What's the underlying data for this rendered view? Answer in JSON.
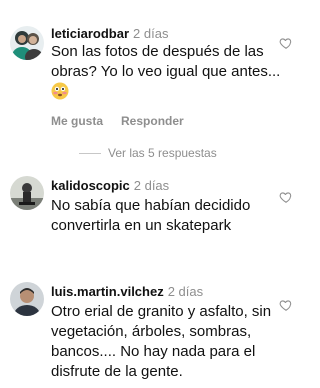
{
  "comments": [
    {
      "username": "leticiarodbar",
      "time": "2 días",
      "text": "Son las fotos de después de las obras? Yo lo veo igual que antes...",
      "emoji": "flushed-face",
      "like_label": "Me gusta",
      "reply_label": "Responder",
      "replies_label": "Ver las 5 respuestas"
    },
    {
      "username": "kalidoscopic",
      "time": "2 días",
      "text": "No sabía que habían decidido convertirla en un skatepark"
    },
    {
      "username": "luis.martin.vilchez",
      "time": "2 días",
      "text": "Otro erial de granito y asfalto, sin vegetación, árboles, sombras, bancos.... No hay nada para el disfrute de la gente."
    }
  ],
  "colors": {
    "secondary_text": "#8e8e8e",
    "primary_text": "#111111"
  }
}
